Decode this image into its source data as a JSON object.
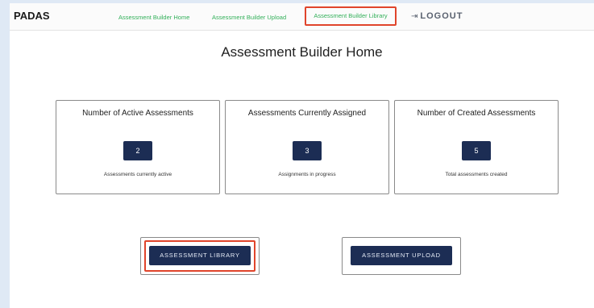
{
  "navbar": {
    "brand": "PADAS",
    "links": [
      {
        "label": "Assessment Builder Home"
      },
      {
        "label": "Assessment Builder Upload"
      },
      {
        "label": "Assessment Builder Library"
      }
    ],
    "logout_icon": "⇥",
    "logout_label": "LOGOUT"
  },
  "page": {
    "title": "Assessment Builder Home"
  },
  "cards": [
    {
      "title": "Number of Active Assessments",
      "value": "2",
      "caption": "Assessments currently active"
    },
    {
      "title": "Assessments Currently Assigned",
      "value": "3",
      "caption": "Assignments in progress"
    },
    {
      "title": "Number of Created Assessments",
      "value": "5",
      "caption": "Total assessments created"
    }
  ],
  "actions": {
    "library_label": "ASSESSMENT LIBRARY",
    "upload_label": "ASSESSMENT UPLOAD"
  },
  "colors": {
    "accent_green": "#33b05a",
    "highlight_red": "#e0442b",
    "navy": "#1c2d54",
    "outer_background": "#dfe9f5"
  }
}
